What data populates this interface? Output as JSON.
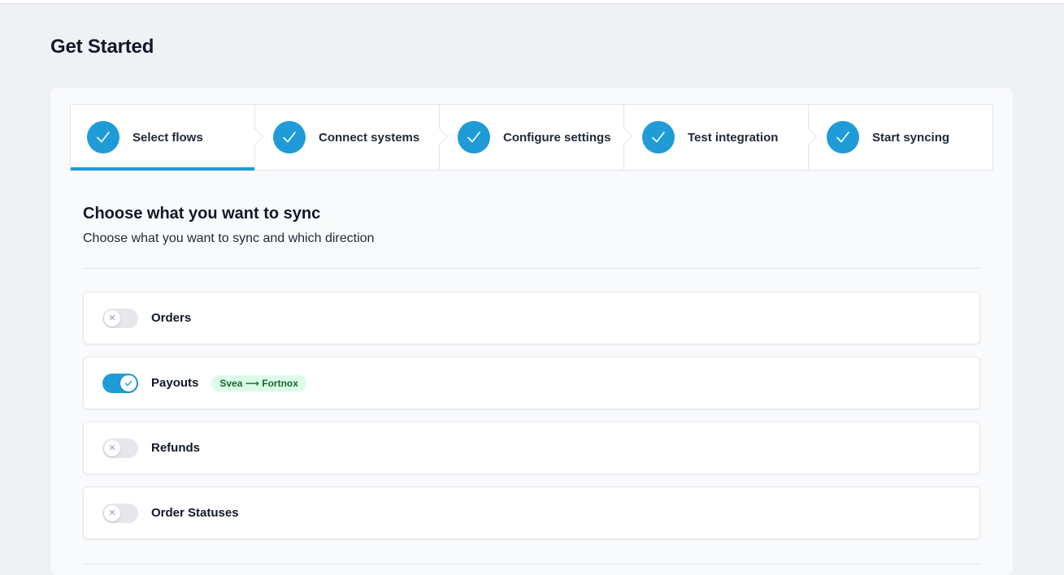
{
  "page": {
    "title": "Get Started"
  },
  "steps": [
    {
      "label": "Select flows",
      "icon": "check-icon",
      "active": true
    },
    {
      "label": "Connect systems",
      "icon": "check-icon"
    },
    {
      "label": "Configure settings",
      "icon": "check-icon"
    },
    {
      "label": "Test integration",
      "icon": "check-icon"
    },
    {
      "label": "Start syncing",
      "icon": "check-icon"
    }
  ],
  "section": {
    "title": "Choose what you want to sync",
    "subtitle": "Choose what you want to sync and which direction"
  },
  "flows": [
    {
      "name": "Orders",
      "enabled": false,
      "toggle_icon": "x-icon"
    },
    {
      "name": "Payouts",
      "enabled": true,
      "toggle_icon": "check-icon",
      "direction": "Svea ⟶ Fortnox"
    },
    {
      "name": "Refunds",
      "enabled": false,
      "toggle_icon": "x-icon"
    },
    {
      "name": "Order Statuses",
      "enabled": false,
      "toggle_icon": "x-icon"
    }
  ],
  "colors": {
    "accent": "#1f9bd8",
    "badge_bg": "#dcfce7",
    "badge_text": "#166534",
    "background": "#f0f1f5"
  }
}
